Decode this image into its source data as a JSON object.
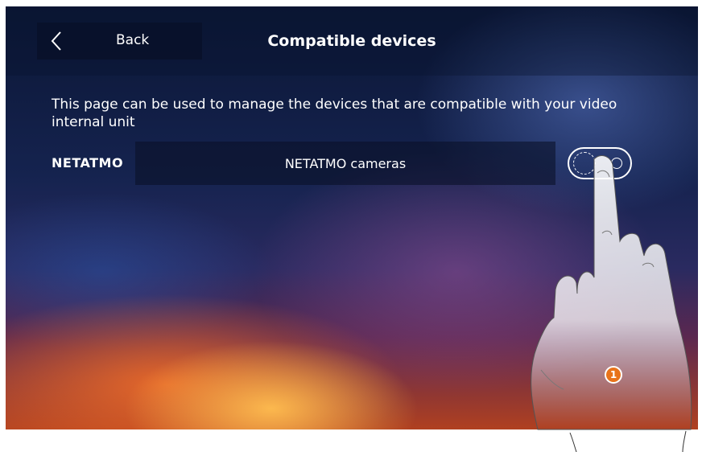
{
  "header": {
    "back_label": "Back",
    "title": "Compatible devices"
  },
  "content": {
    "description": "This page can be used to manage the devices that are compatible with your video internal unit",
    "devices": [
      {
        "brand": "NETATMO",
        "label": "NETATMO cameras",
        "enabled": false
      }
    ]
  },
  "annotation": {
    "step_number": "1"
  },
  "icons": {
    "back": "chevron-left-icon",
    "hand": "pointing-hand-icon"
  },
  "colors": {
    "accent": "#e8731a",
    "text": "#ffffff"
  }
}
